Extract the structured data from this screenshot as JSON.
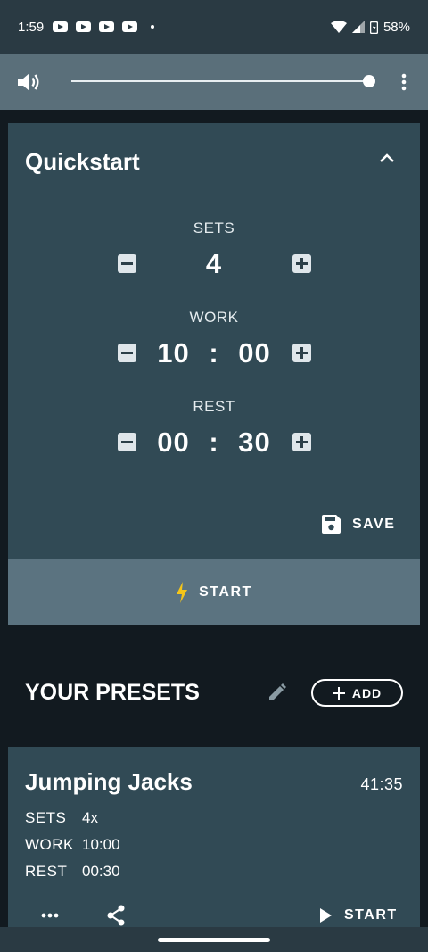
{
  "status_bar": {
    "time": "1:59",
    "notification_icons": [
      "youtube-icon",
      "youtube-icon",
      "youtube-icon",
      "youtube-icon"
    ],
    "battery": "58%"
  },
  "toolbar": {
    "volume_level": 1.0
  },
  "quickstart": {
    "title": "Quickstart",
    "sets_label": "SETS",
    "sets_value": "4",
    "work_label": "WORK",
    "work_minutes": "10",
    "work_seconds": "00",
    "rest_label": "REST",
    "rest_minutes": "00",
    "rest_seconds": "30",
    "separator": ":",
    "save_label": "SAVE",
    "start_label": "START"
  },
  "presets": {
    "title": "YOUR PRESETS",
    "add_label": "ADD",
    "items": [
      {
        "name": "Jumping Jacks",
        "total_time": "41:35",
        "sets_key": "SETS",
        "sets_value": "4x",
        "work_key": "WORK",
        "work_value": "10:00",
        "rest_key": "REST",
        "rest_value": "00:30",
        "start_label": "START"
      }
    ]
  },
  "colors": {
    "accent_bolt": "#f5c518",
    "card_bg": "#314a55",
    "toolbar_bg": "#5a6f7a",
    "page_bg": "#121a20"
  }
}
